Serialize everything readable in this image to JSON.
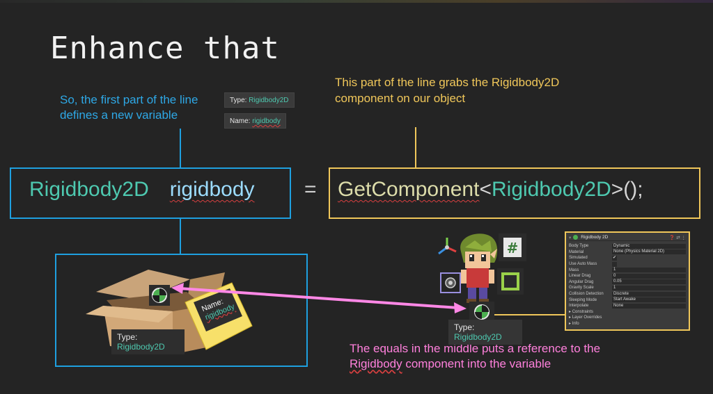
{
  "slide": {
    "title": "Enhance that"
  },
  "notes": {
    "first_part": "So, the first part of the line defines a new variable",
    "second_part": "This part of the line grabs the Rigidbody2D component on our object",
    "equals_part_before": "The equals in the middle puts a reference to the ",
    "equals_part_word": "Rigidbody",
    "equals_part_after": " component into the variable"
  },
  "tooltips": {
    "type_prefix": "Type: ",
    "type_value": "Rigidbody2D",
    "name_prefix": "Name: ",
    "name_value": "rigidbody"
  },
  "code": {
    "left_type": "Rigidbody2D",
    "left_var": "rigidbody",
    "equals": "=",
    "method": "GetComponent",
    "lt": "<",
    "generic_type": "Rigidbody2D",
    "tail": ">();"
  },
  "box_label": {
    "type_prefix": "Type:",
    "type_value": "Rigidbody2D"
  },
  "sticky_note": {
    "prefix": "Name:",
    "value": "rigidbody"
  },
  "object_label": {
    "type_prefix": "Type:",
    "type_value": "Rigidbody2D"
  },
  "inspector": {
    "title": "Rigidbody 2D",
    "rows": [
      {
        "key": "Body Type",
        "value": "Dynamic"
      },
      {
        "key": "Material",
        "value": "None (Physics Material 2D)"
      },
      {
        "key": "Simulated",
        "value": "✔",
        "kind": "check"
      },
      {
        "key": "Use Auto Mass",
        "value": "",
        "kind": "check"
      },
      {
        "key": "Mass",
        "value": "1"
      },
      {
        "key": "Linear Drag",
        "value": "0"
      },
      {
        "key": "Angular Drag",
        "value": "0.05"
      },
      {
        "key": "Gravity Scale",
        "value": "1"
      },
      {
        "key": "Collision Detection",
        "value": "Discrete"
      },
      {
        "key": "Sleeping Mode",
        "value": "Start Awake"
      },
      {
        "key": "Interpolate",
        "value": "None"
      }
    ],
    "folds": [
      "Constraints",
      "Layer Overrides",
      "Info"
    ]
  },
  "colors": {
    "blue": "#1ea0e0",
    "yellow": "#f0c75a",
    "pink": "#ff80dc",
    "teal": "#4ec9b0"
  },
  "icons": [
    "rigidbody-icon",
    "transform-icon",
    "script-icon",
    "sprite-renderer-icon",
    "collider-icon"
  ]
}
